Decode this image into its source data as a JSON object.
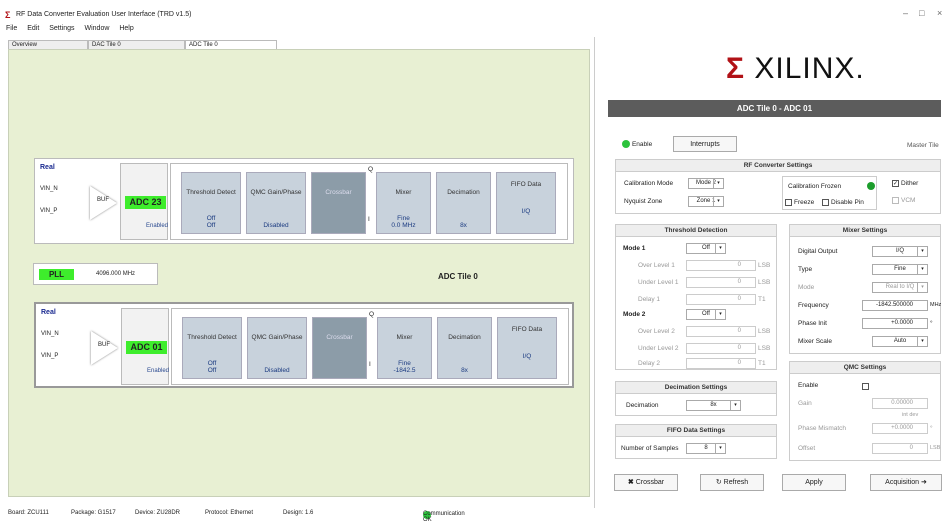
{
  "window": {
    "title": "RF Data Converter Evaluation User Interface (TRD v1.5)",
    "minimize": "–",
    "maximize": "□",
    "close": "×"
  },
  "menu": [
    "File",
    "Edit",
    "Settings",
    "Window",
    "Help"
  ],
  "tabs": [
    "Overview",
    "DAC Tile 0",
    "ADC Tile 0"
  ],
  "channels": [
    {
      "mode": "Real",
      "vin_n": "VIN_N",
      "vin_p": "VIN_P",
      "buf": "BUF",
      "adc": "ADC 23",
      "adc_status": "Enabled",
      "threshold": "Threshold Detect",
      "threshold_val": "Off",
      "threshold_val2": "Off",
      "qmc": "QMC Gain/Phase",
      "qmc_val": "Disabled",
      "crossbar": "Crossbar",
      "mixer": "Mixer",
      "mixer_val": "Fine",
      "mixer_val2": "0.0 MHz",
      "decimation": "Decimation",
      "decimation_val": "8x",
      "fifo": "FIFO Data",
      "fifo_val": "I/Q",
      "q": "Q",
      "i": "I"
    },
    {
      "mode": "Real",
      "vin_n": "VIN_N",
      "vin_p": "VIN_P",
      "buf": "BUF",
      "adc": "ADC 01",
      "adc_status": "Enabled",
      "threshold": "Threshold Detect",
      "threshold_val": "Off",
      "threshold_val2": "Off",
      "qmc": "QMC Gain/Phase",
      "qmc_val": "Disabled",
      "crossbar": "Crossbar",
      "mixer": "Mixer",
      "mixer_val": "Fine",
      "mixer_val2": "-1842.5",
      "decimation": "Decimation",
      "decimation_val": "8x",
      "fifo": "FIFO Data",
      "fifo_val": "I/Q",
      "q": "Q",
      "i": "I"
    }
  ],
  "pll": {
    "label": "PLL",
    "freq": "4096.000 MHz"
  },
  "tile_label": "ADC Tile 0",
  "status": {
    "board": "Board: ZCU111",
    "package": "Package: G1517",
    "device": "Device: ZU28DR",
    "protocol": "Protocol: Ethernet",
    "design": "Design: 1.6",
    "comm": "Communication OK"
  },
  "right": {
    "logo": "XILINX.",
    "header": "ADC Tile 0 - ADC 01",
    "enable": "Enable",
    "interrupts": "Interrupts",
    "master_tile": "Master Tile",
    "rf_settings": {
      "title": "RF Converter Settings",
      "cal_mode_label": "Calibration Mode",
      "cal_mode": "Mode 2",
      "nyquist_label": "Nyquist Zone",
      "nyquist": "Zone 1",
      "cal_frozen": "Calibration Frozen",
      "freeze": "Freeze",
      "disable_pin": "Disable Pin",
      "dither": "Dither",
      "vcm": "VCM"
    },
    "threshold": {
      "title": "Threshold Detection",
      "mode1": "Mode 1",
      "mode1_val": "Off",
      "over1": "Over Level 1",
      "over1_val": "0",
      "under1": "Under Level 1",
      "under1_val": "0",
      "delay1": "Delay 1",
      "delay1_val": "0",
      "mode2": "Mode 2",
      "mode2_val": "Off",
      "over2": "Over Level 2",
      "over2_val": "0",
      "under2": "Under Level 2",
      "under2_val": "0",
      "delay2": "Delay 2",
      "delay2_val": "0",
      "lsb": "LSB",
      "t1": "T1"
    },
    "mixer": {
      "title": "Mixer Settings",
      "digital_output": "Digital Output",
      "digital_output_val": "I/Q",
      "type": "Type",
      "type_val": "Fine",
      "mode": "Mode",
      "mode_val": "Real to I/Q",
      "frequency": "Frequency",
      "frequency_val": "-1842.500000",
      "mhz": "MHz",
      "phase_init": "Phase Init",
      "phase_init_val": "+0.0000",
      "deg": "°",
      "mixer_scale": "Mixer Scale",
      "mixer_scale_val": "Auto"
    },
    "qmc": {
      "title": "QMC Settings",
      "enable": "Enable",
      "gain": "Gain",
      "gain_val": "0.00000",
      "gain_unit": "int dev",
      "phase_mismatch": "Phase Mismatch",
      "phase_val": "+0.0000",
      "deg": "°",
      "offset": "Offset",
      "offset_val": "0",
      "lsb": "LSB"
    },
    "decimation": {
      "title": "Decimation Settings",
      "label": "Decimation",
      "val": "8x"
    },
    "fifo": {
      "title": "FIFO Data Settings",
      "label": "Number of Samples",
      "val": "8"
    },
    "buttons": {
      "crossbar": "Crossbar",
      "refresh": "Refresh",
      "apply": "Apply",
      "acquisition": "Acquisition"
    }
  }
}
